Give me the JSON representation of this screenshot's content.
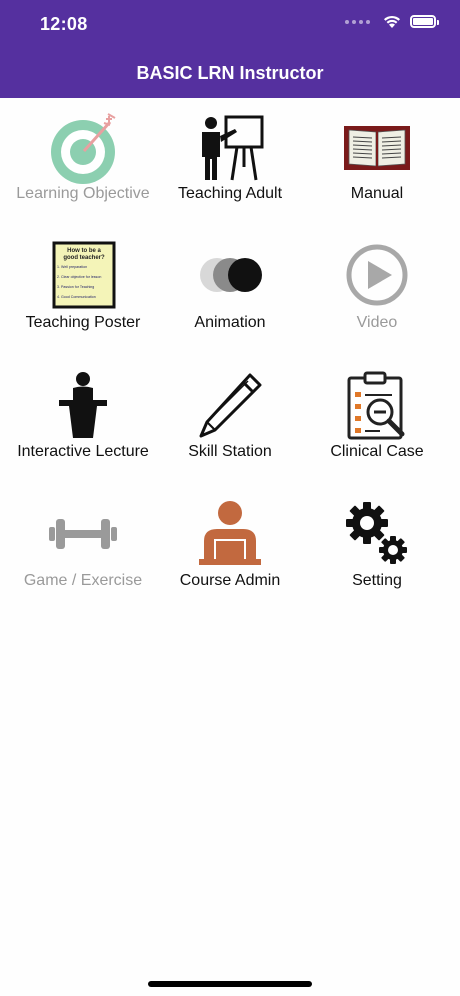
{
  "status_bar": {
    "time": "12:08"
  },
  "nav": {
    "title": "BASIC LRN Instructor"
  },
  "colors": {
    "header": "#55309f",
    "text": "#111111",
    "disabled_text": "#9a9a9a"
  },
  "tiles": [
    {
      "label": "Learning Objective",
      "icon": "target-icon",
      "enabled": false
    },
    {
      "label": "Teaching Adult",
      "icon": "teacher-board-icon",
      "enabled": true
    },
    {
      "label": "Manual",
      "icon": "open-book-icon",
      "enabled": true
    },
    {
      "label": "Teaching Poster",
      "icon": "poster-icon",
      "enabled": true
    },
    {
      "label": "Animation",
      "icon": "animation-circles-icon",
      "enabled": true
    },
    {
      "label": "Video",
      "icon": "play-icon",
      "enabled": false
    },
    {
      "label": "Interactive Lecture",
      "icon": "lecturer-podium-icon",
      "enabled": true
    },
    {
      "label": "Skill Station",
      "icon": "pencil-icon",
      "enabled": true
    },
    {
      "label": "Clinical Case",
      "icon": "clipboard-search-icon",
      "enabled": true
    },
    {
      "label": "Game / Exercise",
      "icon": "dumbbell-icon",
      "enabled": false
    },
    {
      "label": "Course Admin",
      "icon": "admin-user-icon",
      "enabled": true
    },
    {
      "label": "Setting",
      "icon": "gears-icon",
      "enabled": true
    }
  ],
  "poster": {
    "title": "How to be a good teacher?",
    "items": [
      "1. Well preparation",
      "2. Clear objective for lesson",
      "3. Passion for Teaching",
      "4. Good Communication"
    ]
  }
}
